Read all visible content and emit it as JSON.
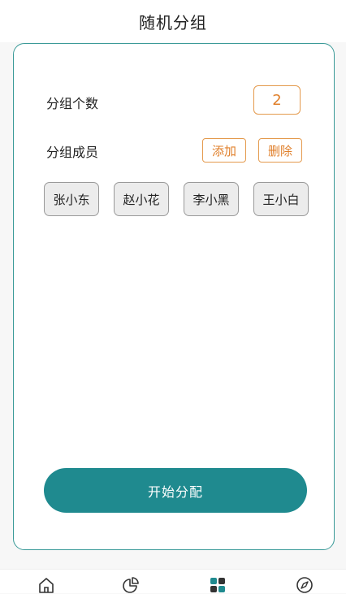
{
  "header": {
    "title": "随机分组"
  },
  "group_count": {
    "label": "分组个数",
    "value": "2"
  },
  "members": {
    "label": "分组成员",
    "add_label": "添加",
    "delete_label": "删除",
    "list": [
      "张小东",
      "赵小花",
      "李小黑",
      "王小白"
    ]
  },
  "start_button": {
    "label": "开始分配"
  },
  "tabbar": {
    "icons": [
      "home-icon",
      "pie-chart-icon",
      "grid-icon",
      "compass-icon"
    ],
    "active_index": 2
  },
  "colors": {
    "accent": "#1f8a8f",
    "card_border": "#3a9a98",
    "orange": "#e07f2a",
    "chip_bg": "#ececec"
  }
}
